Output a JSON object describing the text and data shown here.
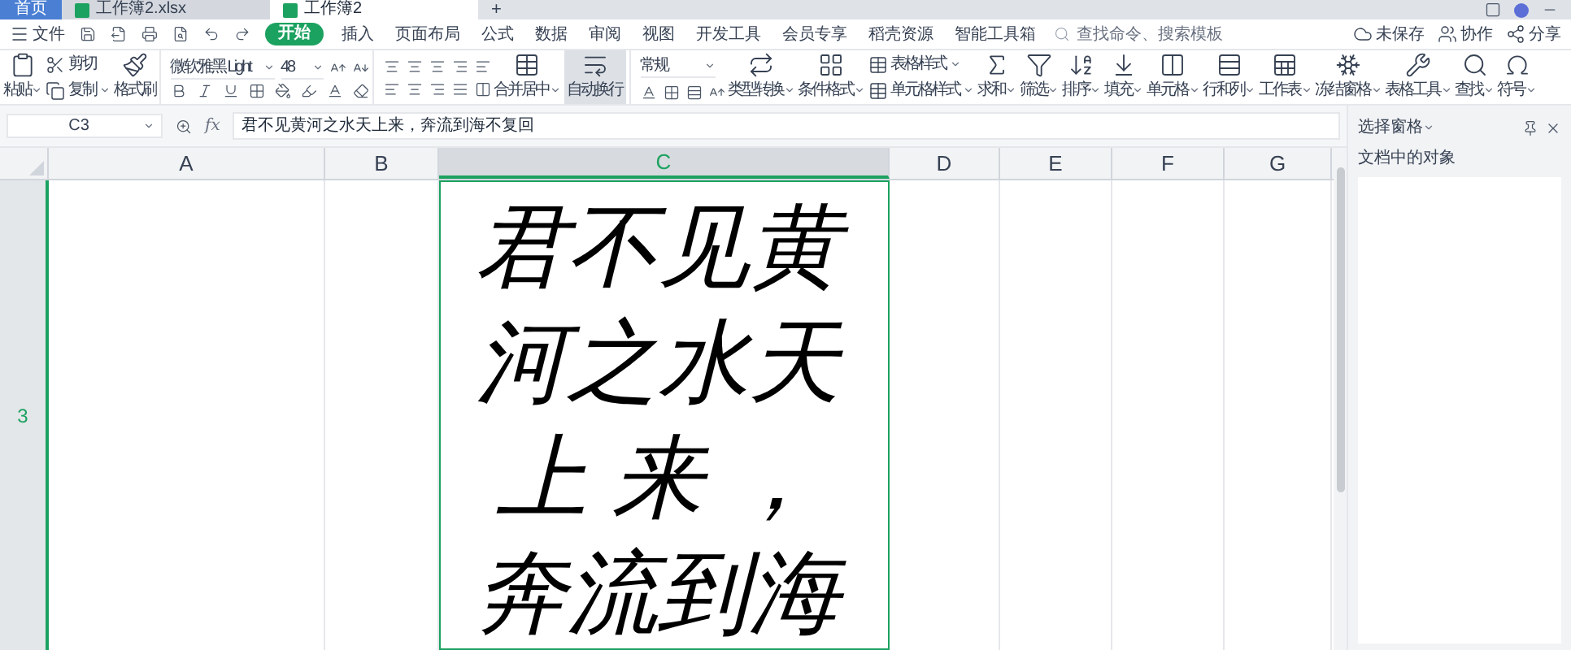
{
  "tabs": [
    {
      "label": "首页",
      "kind": "home",
      "selected": false
    },
    {
      "label": "工作簿2.xlsx",
      "kind": "doc",
      "selected": false
    },
    {
      "label": "工作簿2",
      "kind": "doc",
      "selected": true
    }
  ],
  "new_tab": "+",
  "menu": {
    "file": "文件",
    "items": [
      {
        "label": "开始",
        "selected": true
      },
      {
        "label": "插入",
        "selected": false
      },
      {
        "label": "页面布局",
        "selected": false
      },
      {
        "label": "公式",
        "selected": false
      },
      {
        "label": "数据",
        "selected": false
      },
      {
        "label": "审阅",
        "selected": false
      },
      {
        "label": "视图",
        "selected": false
      },
      {
        "label": "开发工具",
        "selected": false
      },
      {
        "label": "会员专享",
        "selected": false
      },
      {
        "label": "稻壳资源",
        "selected": false
      },
      {
        "label": "智能工具箱",
        "selected": false
      }
    ],
    "search": {
      "placeholder": "查找命令、搜索模板"
    },
    "actions": [
      "未保存",
      "协作",
      "分享"
    ]
  },
  "ribbon": {
    "paste": "粘贴",
    "cut": "剪切",
    "copy": "复制",
    "format_painter": "格式刷",
    "font": {
      "name": "微软雅黑 Light",
      "size": "48"
    },
    "merge": "合并居中",
    "wrap": {
      "label": "自动换行",
      "on": true
    },
    "number_format": "常规",
    "convert": "类型转换",
    "groups": [
      {
        "label": "条件格式",
        "kind": "big"
      },
      {
        "label": "表格样式",
        "kind": "small"
      },
      {
        "label": "单元格样式",
        "kind": "small"
      },
      {
        "label": "求和",
        "kind": "big"
      },
      {
        "label": "筛选",
        "kind": "big"
      },
      {
        "label": "排序",
        "kind": "big"
      },
      {
        "label": "填充",
        "kind": "big"
      },
      {
        "label": "单元格",
        "kind": "big"
      },
      {
        "label": "行和列",
        "kind": "big"
      },
      {
        "label": "工作表",
        "kind": "big"
      },
      {
        "label": "冻结窗格",
        "kind": "big"
      },
      {
        "label": "表格工具",
        "kind": "big"
      },
      {
        "label": "查找",
        "kind": "big"
      },
      {
        "label": "符号",
        "kind": "big"
      }
    ]
  },
  "formula_bar": {
    "cell": "C3",
    "fx": "fx",
    "value": "君不见黄河之水天上来，奔流到海不复回"
  },
  "sheet": {
    "columns": [
      {
        "label": "A",
        "selected": false
      },
      {
        "label": "B",
        "selected": false
      },
      {
        "label": "C",
        "selected": true
      },
      {
        "label": "D",
        "selected": false
      },
      {
        "label": "E",
        "selected": false
      },
      {
        "label": "F",
        "selected": false
      },
      {
        "label": "G",
        "selected": false
      }
    ],
    "row": {
      "label": "3",
      "selected": true
    },
    "cell_lines": [
      "君不见黄",
      "河之水天",
      "上 来 ，",
      "奔流到海"
    ]
  },
  "pane": {
    "title": "选择窗格",
    "subtitle": "文档中的对象"
  }
}
